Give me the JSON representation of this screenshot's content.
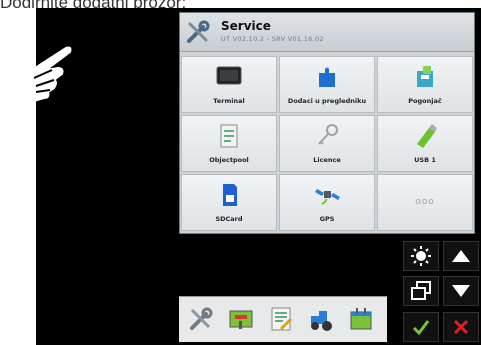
{
  "caption": "Dodirnite dodatni prozor:",
  "service": {
    "title": "Service",
    "version": "UT V02.10.2 - SRV V01.16.02"
  },
  "tiles": [
    {
      "label": "Terminal",
      "icon": "terminal-icon"
    },
    {
      "label": "Dodaci u pregledniku",
      "icon": "puzzle-icon"
    },
    {
      "label": "Pogonjač",
      "icon": "driver-icon"
    },
    {
      "label": "Objectpool",
      "icon": "objectpool-icon"
    },
    {
      "label": "Licence",
      "icon": "key-icon"
    },
    {
      "label": "USB 1",
      "icon": "usb-icon"
    },
    {
      "label": "SDCard",
      "icon": "sdcard-icon"
    },
    {
      "label": "GPS",
      "icon": "satellite-icon"
    },
    {
      "label": "ooo",
      "icon": "more-icon"
    }
  ],
  "side_buttons": [
    "brightness-icon",
    "arrow-up-icon",
    "window-switch-icon",
    "arrow-down-icon",
    "confirm-icon",
    "cancel-icon"
  ],
  "bottom_bar": [
    "tools-icon",
    "field-map-icon",
    "checklist-icon",
    "tractor-icon",
    "calendar-icon"
  ]
}
